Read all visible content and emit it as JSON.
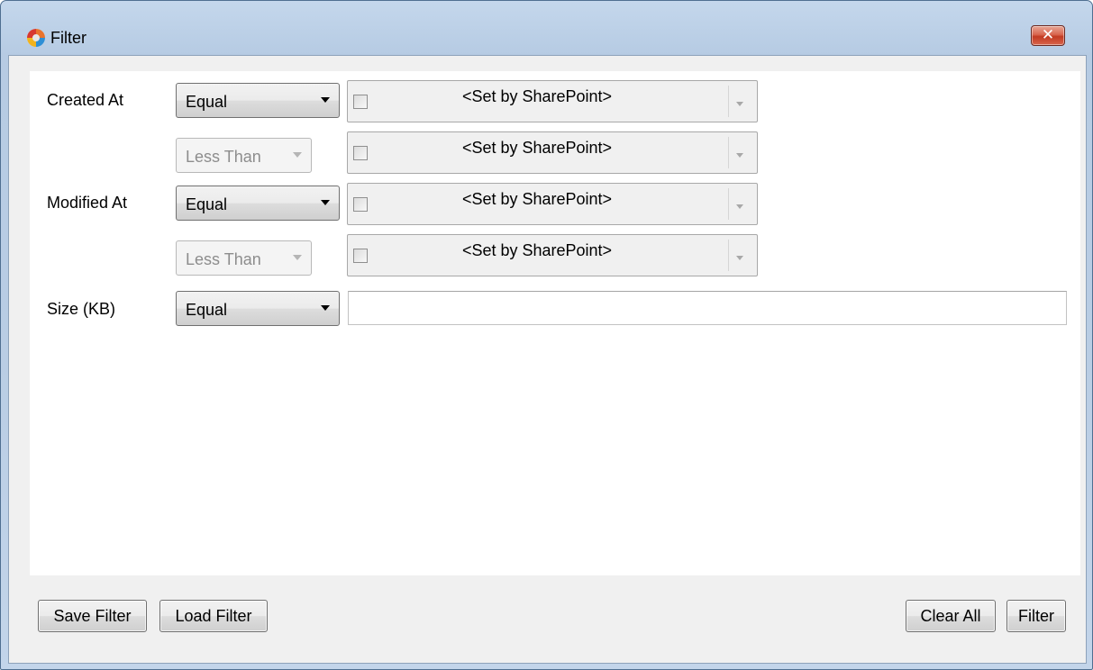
{
  "window": {
    "title": "Filter",
    "close_symbol": "✕",
    "app_icon": "app-logo-icon"
  },
  "rows": [
    {
      "label": "Created At",
      "operator": "Equal",
      "value": "<Set by SharePoint>"
    },
    {
      "operator": "Less Than",
      "value": "<Set by SharePoint>"
    },
    {
      "label": "Modified At",
      "operator": "Equal",
      "value": "<Set by SharePoint>"
    },
    {
      "operator": "Less Than",
      "value": "<Set by SharePoint>"
    },
    {
      "label": "Size (KB)",
      "operator": "Equal",
      "value": ""
    }
  ],
  "buttons": {
    "save_filter": "Save Filter",
    "load_filter": "Load Filter",
    "clear_all": "Clear All",
    "filter": "Filter"
  },
  "colors": {
    "title_bar": "#b9cde4",
    "close_button": "#c23a22",
    "client_background": "#f0f0f0",
    "disabled_text": "#8d8d8d"
  }
}
